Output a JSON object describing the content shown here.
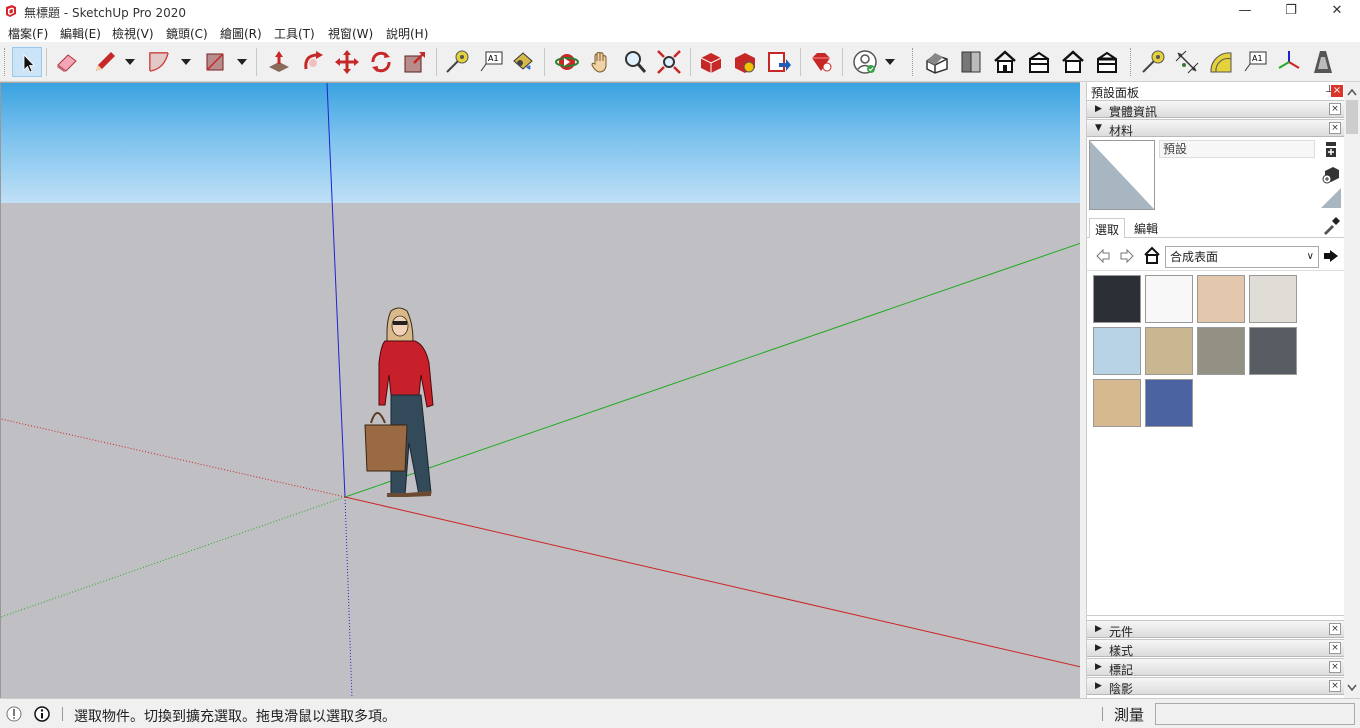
{
  "window": {
    "title": "無標題 - SketchUp Pro 2020",
    "minimize_glyph": "—",
    "restore_glyph": "❐",
    "close_glyph": "✕"
  },
  "menu": {
    "items": [
      {
        "label": "檔案(F)"
      },
      {
        "label": "編輯(E)"
      },
      {
        "label": "檢視(V)"
      },
      {
        "label": "鏡頭(C)"
      },
      {
        "label": "繪圖(R)"
      },
      {
        "label": "工具(T)"
      },
      {
        "label": "視窗(W)"
      },
      {
        "label": "說明(H)"
      }
    ]
  },
  "toolbar": {
    "icons": [
      "select-icon",
      "eraser-icon",
      "pencil-line-icon",
      "arc-icon",
      "rectangle-icon",
      "push-pull-icon",
      "follow-me-icon",
      "move-icon",
      "rotate-icon",
      "scale-icon",
      "tape-measure-icon",
      "text-icon",
      "paint-bucket-icon",
      "orbit-icon",
      "pan-icon",
      "zoom-icon",
      "zoom-extents-icon",
      "warehouse-icon",
      "extension-warehouse-icon",
      "layout-send-icon",
      "ruby-console-icon",
      "account-icon",
      "iso-view-icon",
      "top-view-icon",
      "front-view-icon",
      "right-view-icon",
      "back-view-icon",
      "left-view-icon",
      "dimension-icon",
      "protractor-icon",
      "axes-icon",
      "3d-text-icon",
      "section-plane-icon"
    ]
  },
  "tray": {
    "title": "預設面板",
    "pin_glyph": "📌",
    "close_glyph": "×",
    "entity_info": {
      "label": "實體資訊",
      "arrow": "▶"
    },
    "materials": {
      "label": "材料",
      "arrow": "▼",
      "name": "預設",
      "tabs": [
        {
          "label": "選取"
        },
        {
          "label": "編輯"
        }
      ],
      "collection": "合成表面",
      "swatch_colors": [
        "#2c3036",
        "#f8f8f8",
        "#e2c7ad",
        "#e0ddd6",
        "#b8d2e6",
        "#c9b792",
        "#939184",
        "#575d63",
        "#d6b98e",
        "#4b63a0"
      ]
    },
    "collapsed_panels": [
      {
        "label": "元件",
        "arrow": "▶"
      },
      {
        "label": "樣式",
        "arrow": "▶"
      },
      {
        "label": "標記",
        "arrow": "▶"
      },
      {
        "label": "陰影",
        "arrow": "▶"
      }
    ]
  },
  "status": {
    "text": "選取物件。切換到擴充選取。拖曳滑鼠以選取多項。",
    "measure_label": "測量",
    "measure_value": ""
  },
  "colors": {
    "red_axis": "#cc2222",
    "green_axis": "#22aa22",
    "blue_axis": "#2222cc",
    "ground": "#c0c0c4",
    "sky_top": "#3aa2e0"
  }
}
